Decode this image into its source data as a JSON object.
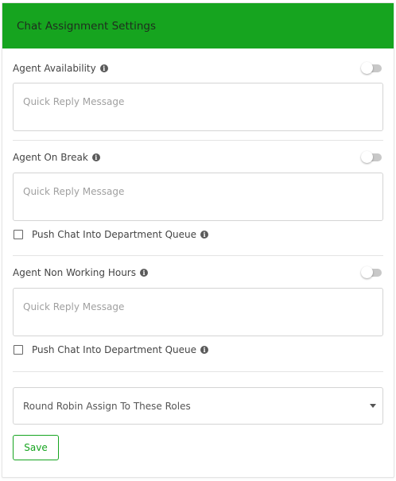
{
  "header": {
    "title": "Chat Assignment Settings"
  },
  "sections": [
    {
      "title": "Agent Availability",
      "toggle_on": false,
      "message_placeholder": "Quick Reply Message"
    },
    {
      "title": "Agent On Break",
      "toggle_on": false,
      "message_placeholder": "Quick Reply Message",
      "checkbox_label": "Push Chat Into Department Queue",
      "checkbox_checked": false
    },
    {
      "title": "Agent Non Working Hours",
      "toggle_on": false,
      "message_placeholder": "Quick Reply Message",
      "checkbox_label": "Push Chat Into Department Queue",
      "checkbox_checked": false
    }
  ],
  "roles_select": {
    "placeholder": "Round Robin Assign To These Roles"
  },
  "save_label": "Save",
  "colors": {
    "accent": "#16a41f",
    "border": "#d4d4d4"
  },
  "icons": {
    "info": "info-icon",
    "caret": "chevron-down-icon"
  }
}
